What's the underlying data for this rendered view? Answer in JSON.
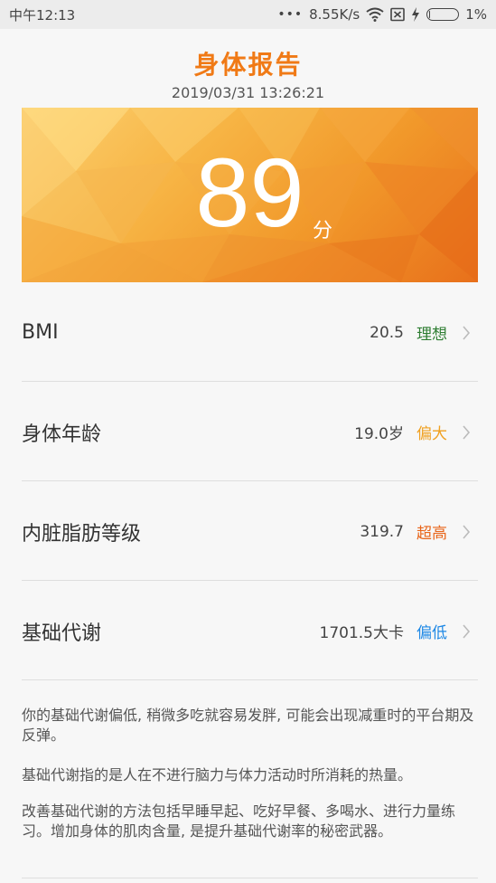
{
  "status_bar": {
    "time": "中午12:13",
    "dots": "•••",
    "network_speed": "8.55K/s",
    "battery_percent": "1%",
    "battery_level": 0.01
  },
  "header": {
    "title": "身体报告",
    "timestamp": "2019/03/31 13:26:21"
  },
  "score": {
    "value": "89",
    "unit": "分"
  },
  "metrics": [
    {
      "label": "BMI",
      "value": "20.5",
      "status": "理想",
      "status_color": "#2e7d32"
    },
    {
      "label": "身体年龄",
      "value": "19.0岁",
      "status": "偏大",
      "status_color": "#f0a020"
    },
    {
      "label": "内脏脂肪等级",
      "value": "319.7",
      "status": "超高",
      "status_color": "#e8651a"
    },
    {
      "label": "基础代谢",
      "value": "1701.5大卡",
      "status": "偏低",
      "status_color": "#1e88e5"
    }
  ],
  "advice": [
    "你的基础代谢偏低, 稍微多吃就容易发胖, 可能会出现减重时的平台期及反弹。",
    "基础代谢指的是人在不进行脑力与体力活动时所消耗的热量。",
    "改善基础代谢的方法包括早睡早起、吃好早餐、多喝水、进行力量练习。增加身体的肌肉含量, 是提升基础代谢率的秘密武器。"
  ],
  "colors": {
    "accent": "#f07a16"
  },
  "icons": {
    "wifi": "wifi-icon",
    "sim": "sim-card-icon",
    "charging": "charging-bolt-icon",
    "battery": "battery-icon",
    "chevron": "chevron-right-icon"
  }
}
